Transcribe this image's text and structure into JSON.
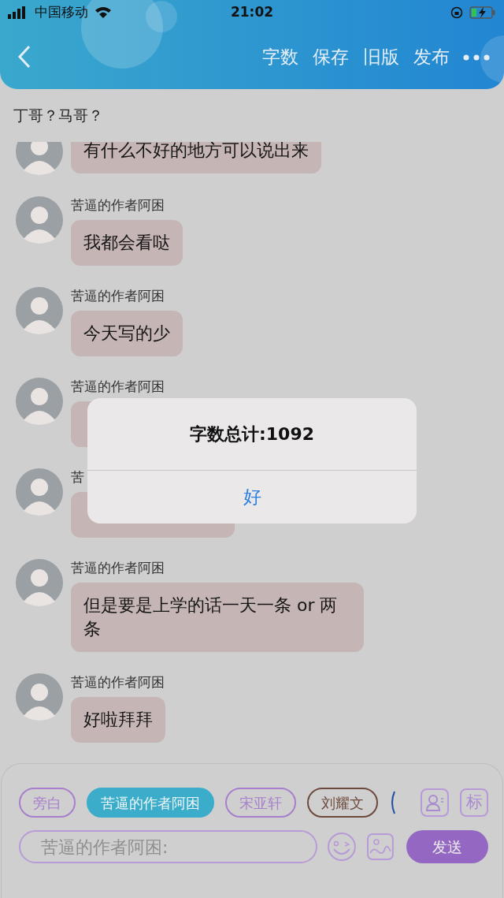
{
  "status_bar": {
    "carrier": "中国移动",
    "time": "21:02"
  },
  "header": {
    "actions": [
      "字数",
      "保存",
      "旧版",
      "发布"
    ]
  },
  "topic": "丁哥？马哥？",
  "messages": [
    {
      "text": "有什么不好的地方可以说出来"
    },
    {
      "sender": "苦逼的作者阿困",
      "text": "我都会看哒"
    },
    {
      "sender": "苦逼的作者阿困",
      "text": "今天写的少"
    },
    {
      "sender": "苦逼的作者阿困"
    },
    {
      "sender": "苦"
    },
    {
      "sender": "苦逼的作者阿困",
      "text": "但是要是上学的话一天一条 or 两条"
    },
    {
      "sender": "苦逼的作者阿困",
      "text": "好啦拜拜"
    }
  ],
  "roles": [
    {
      "label": "旁白",
      "selected": false,
      "color": "#a77fcc"
    },
    {
      "label": "苦逼的作者阿困",
      "selected": true,
      "color": "#3badcb"
    },
    {
      "label": "宋亚轩",
      "selected": false,
      "color": "#a77fcc"
    },
    {
      "label": "刘耀文",
      "selected": false,
      "color": "#6e4a3c"
    }
  ],
  "tag_button": "标",
  "input": {
    "placeholder": "苦逼的作者阿困:"
  },
  "send_button": "发送",
  "alert": {
    "title": "字数总计:1092",
    "button": "好"
  }
}
